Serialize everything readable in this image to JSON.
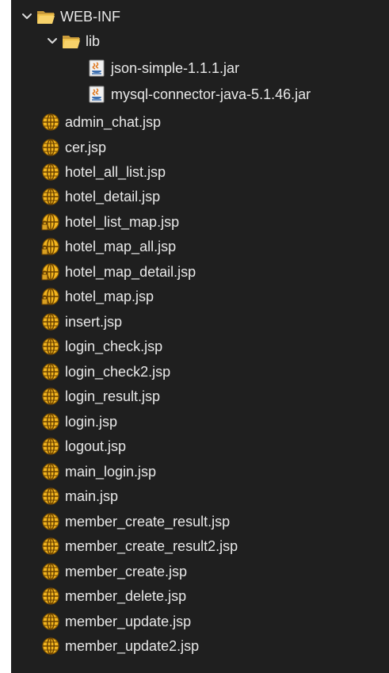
{
  "tree": {
    "folders": [
      {
        "label": "WEB-INF",
        "icon": "folder-icon",
        "expanded": true
      },
      {
        "label": "lib",
        "icon": "folder-icon",
        "expanded": true
      }
    ],
    "jars": [
      {
        "label": "json-simple-1.1.1.jar",
        "icon": "jar-file-icon"
      },
      {
        "label": "mysql-connector-java-5.1.46.jar",
        "icon": "jar-file-icon"
      }
    ],
    "jsp_files": [
      {
        "label": "admin_chat.jsp",
        "icon": "jsp-globe-icon"
      },
      {
        "label": "cer.jsp",
        "icon": "jsp-globe-icon"
      },
      {
        "label": "hotel_all_list.jsp",
        "icon": "jsp-globe-icon"
      },
      {
        "label": "hotel_detail.jsp",
        "icon": "jsp-globe-icon"
      },
      {
        "label": "hotel_list_map.jsp",
        "icon": "jsp-globe-locked-icon"
      },
      {
        "label": "hotel_map_all.jsp",
        "icon": "jsp-globe-locked-icon"
      },
      {
        "label": "hotel_map_detail.jsp",
        "icon": "jsp-globe-locked-icon"
      },
      {
        "label": "hotel_map.jsp",
        "icon": "jsp-globe-locked-icon"
      },
      {
        "label": "insert.jsp",
        "icon": "jsp-globe-icon"
      },
      {
        "label": "login_check.jsp",
        "icon": "jsp-globe-icon"
      },
      {
        "label": "login_check2.jsp",
        "icon": "jsp-globe-icon"
      },
      {
        "label": "login_result.jsp",
        "icon": "jsp-globe-icon"
      },
      {
        "label": "login.jsp",
        "icon": "jsp-globe-icon"
      },
      {
        "label": "logout.jsp",
        "icon": "jsp-globe-icon"
      },
      {
        "label": "main_login.jsp",
        "icon": "jsp-globe-icon"
      },
      {
        "label": "main.jsp",
        "icon": "jsp-globe-icon"
      },
      {
        "label": "member_create_result.jsp",
        "icon": "jsp-globe-icon"
      },
      {
        "label": "member_create_result2.jsp",
        "icon": "jsp-globe-icon"
      },
      {
        "label": "member_create.jsp",
        "icon": "jsp-globe-icon"
      },
      {
        "label": "member_delete.jsp",
        "icon": "jsp-globe-icon"
      },
      {
        "label": "member_update.jsp",
        "icon": "jsp-globe-icon"
      },
      {
        "label": "member_update2.jsp",
        "icon": "jsp-globe-icon"
      }
    ]
  }
}
